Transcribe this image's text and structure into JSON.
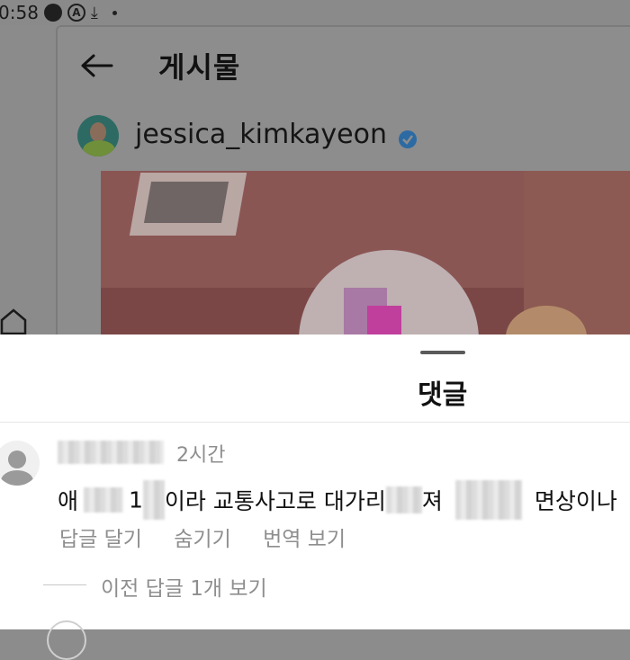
{
  "status_bar": {
    "time": "0:58",
    "icons": [
      "chat-bubble-icon",
      "a-circle-icon",
      "download-icon",
      "dot-icon"
    ]
  },
  "post": {
    "header_title": "게시물",
    "back_icon": "back-arrow-icon",
    "username": "jessica_kimkayeon",
    "verified_icon": "verified-badge-icon"
  },
  "comments_sheet": {
    "title": "댓글",
    "comment": {
      "time": "2시간",
      "text_parts": [
        "애",
        "1",
        "이라 교통사고로 대가리",
        "져",
        "면상이나"
      ],
      "actions": {
        "reply": "답글 달기",
        "hide": "숨기기",
        "translate": "번역 보기"
      },
      "view_replies": "이전 답글 1개 보기"
    }
  },
  "colors": {
    "overlay_dim": "#8c8c8c",
    "sheet_bg": "#ffffff",
    "secondary_text": "#8e8e8e",
    "verified_blue": "#3897f0"
  }
}
